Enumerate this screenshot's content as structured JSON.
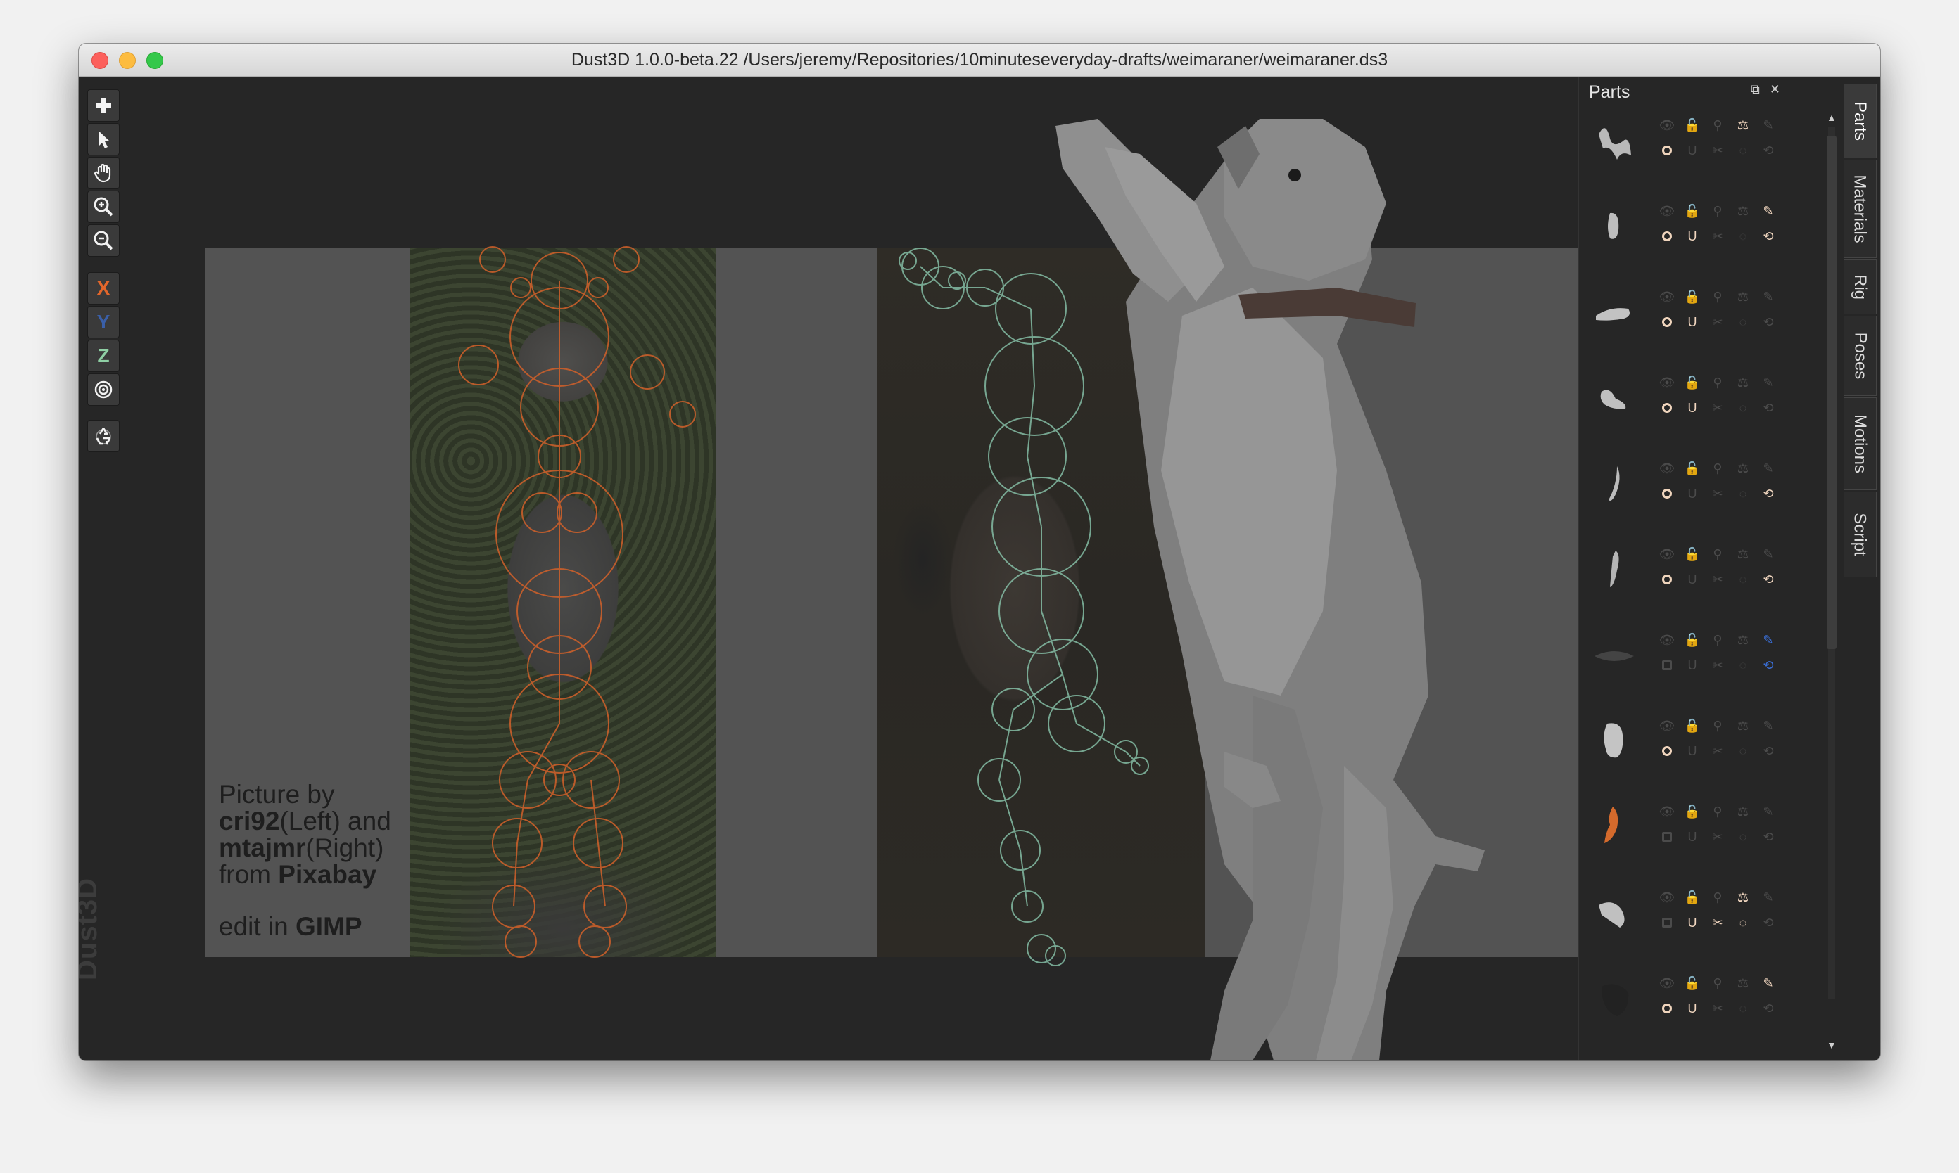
{
  "window": {
    "title": "Dust3D 1.0.0-beta.22 /Users/jeremy/Repositories/10minuteseveryday-drafts/weimaraner/weimaraner.ds3"
  },
  "toolbar": {
    "tools": [
      {
        "name": "add-tool",
        "icon": "plus-icon"
      },
      {
        "name": "select-tool",
        "icon": "cursor-arrow-icon"
      },
      {
        "name": "pan-tool",
        "icon": "hand-icon"
      },
      {
        "name": "zoom-in-tool",
        "icon": "zoom-in-icon"
      },
      {
        "name": "zoom-out-tool",
        "icon": "zoom-out-icon"
      },
      {
        "name": "x-axis-lock",
        "label": "X",
        "color": "#e2662b"
      },
      {
        "name": "y-axis-lock",
        "label": "Y",
        "color": "#3a5fa8"
      },
      {
        "name": "z-axis-lock",
        "label": "Z",
        "color": "#8fd0a5"
      },
      {
        "name": "radius-lock",
        "icon": "target-icon"
      },
      {
        "name": "regenerate-button",
        "icon": "recycle-icon"
      }
    ]
  },
  "credit": {
    "line1": "Picture by",
    "author_left": "cri92",
    "left_suffix": "(Left) and",
    "author_right": "mtajmr",
    "right_suffix": "(Right)",
    "from": "from ",
    "source": "Pixabay",
    "edit_prefix": "edit in ",
    "edit_tool": "GIMP"
  },
  "watermark": "Dust3D",
  "parts_panel": {
    "title": "Parts",
    "float_icon": "float-window-icon",
    "close_icon": "close-icon",
    "parts": [
      {
        "thumb_color": "#b9b9b9",
        "shape": "legs",
        "ring": true,
        "bolt_on": false,
        "pencil_on": false,
        "scale_on": true,
        "wrap_on": false,
        "cut_on": false,
        "blue": false
      },
      {
        "thumb_color": "#bdbdbd",
        "shape": "ear",
        "ring": true,
        "bolt_on": true,
        "pencil_on": true,
        "scale_on": false,
        "wrap_on": true,
        "cut_on": false,
        "blue": false
      },
      {
        "thumb_color": "#c2c2c2",
        "shape": "flat",
        "ring": true,
        "bolt_on": true,
        "pencil_on": false,
        "scale_on": false,
        "wrap_on": false,
        "cut_on": false,
        "blue": false
      },
      {
        "thumb_color": "#bfbfbf",
        "shape": "paw",
        "ring": true,
        "bolt_on": true,
        "pencil_on": false,
        "scale_on": false,
        "wrap_on": false,
        "cut_on": false,
        "blue": false
      },
      {
        "thumb_color": "#bbbbbb",
        "shape": "thin",
        "ring": true,
        "bolt_on": false,
        "pencil_on": false,
        "scale_on": false,
        "wrap_on": true,
        "cut_on": false,
        "blue": false
      },
      {
        "thumb_color": "#b5b5b5",
        "shape": "leg",
        "ring": true,
        "bolt_on": false,
        "pencil_on": false,
        "scale_on": false,
        "wrap_on": true,
        "cut_on": false,
        "blue": false
      },
      {
        "thumb_color": "#444444",
        "shape": "collar",
        "ring": false,
        "bolt_on": false,
        "pencil_on": true,
        "scale_on": false,
        "wrap_on": true,
        "cut_on": false,
        "blue": true
      },
      {
        "thumb_color": "#c4c4c4",
        "shape": "head",
        "ring": true,
        "bolt_on": false,
        "pencil_on": false,
        "scale_on": false,
        "wrap_on": false,
        "cut_on": false,
        "blue": false
      },
      {
        "thumb_color": "#d46a2c",
        "shape": "orange",
        "ring": false,
        "bolt_on": false,
        "pencil_on": false,
        "scale_on": false,
        "wrap_on": false,
        "cut_on": false,
        "blue": false
      },
      {
        "thumb_color": "#c0c0c0",
        "shape": "paw2",
        "ring": false,
        "bolt_on": true,
        "pencil_on": false,
        "scale_on": true,
        "wrap_on": false,
        "cut_on": true,
        "blue": false
      },
      {
        "thumb_color": "#222222",
        "shape": "nose",
        "ring": true,
        "bolt_on": true,
        "pencil_on": true,
        "scale_on": false,
        "wrap_on": false,
        "cut_on": false,
        "blue": false
      },
      {
        "thumb_color": "#9a9a9a",
        "shape": "dots",
        "ring": true,
        "bolt_on": true,
        "pencil_on": false,
        "scale_on": true,
        "wrap_on": false,
        "cut_on": false,
        "blue": false
      },
      {
        "thumb_color": "#9a9a9a",
        "shape": "partial",
        "ring": true,
        "bolt_on": false,
        "pencil_on": false,
        "scale_on": true,
        "wrap_on": false,
        "cut_on": false,
        "blue": false
      }
    ]
  },
  "side_tabs": [
    "Parts",
    "Materials",
    "Rig",
    "Poses",
    "Motions",
    "Script"
  ],
  "colors": {
    "front_view_nodes": "#d2612a",
    "side_view_nodes": "#8fd0b5",
    "model": "#8d8d8d"
  }
}
